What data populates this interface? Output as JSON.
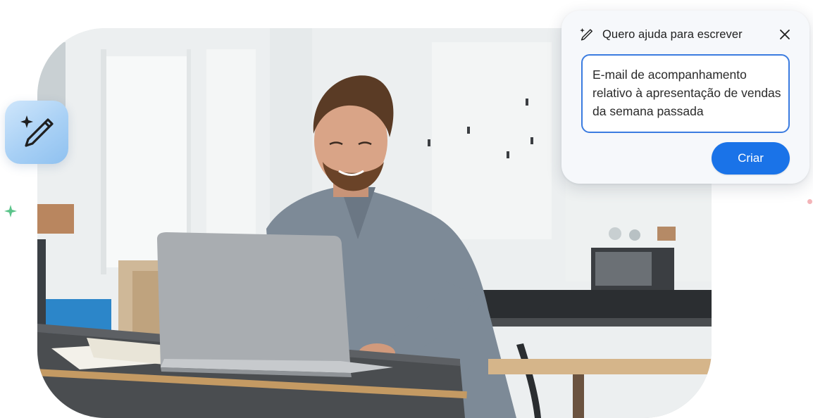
{
  "help_card": {
    "title": "Quero ajuda para escrever",
    "prompt_text": "E-mail de acompanhamento relativo à apresentação de vendas da semana passada",
    "create_label": "Criar",
    "header_icon": "magic-pen-icon",
    "close_icon": "close-icon"
  },
  "floating_tile": {
    "icon": "magic-pen-icon"
  },
  "colors": {
    "accent": "#1a73e8",
    "field_border": "#3b7ce0",
    "card_background": "#f6f8fb",
    "tile_blue": "#a8d0f5",
    "sparkle_green": "#5bc48a",
    "dot_pink": "#f3b4b8"
  }
}
